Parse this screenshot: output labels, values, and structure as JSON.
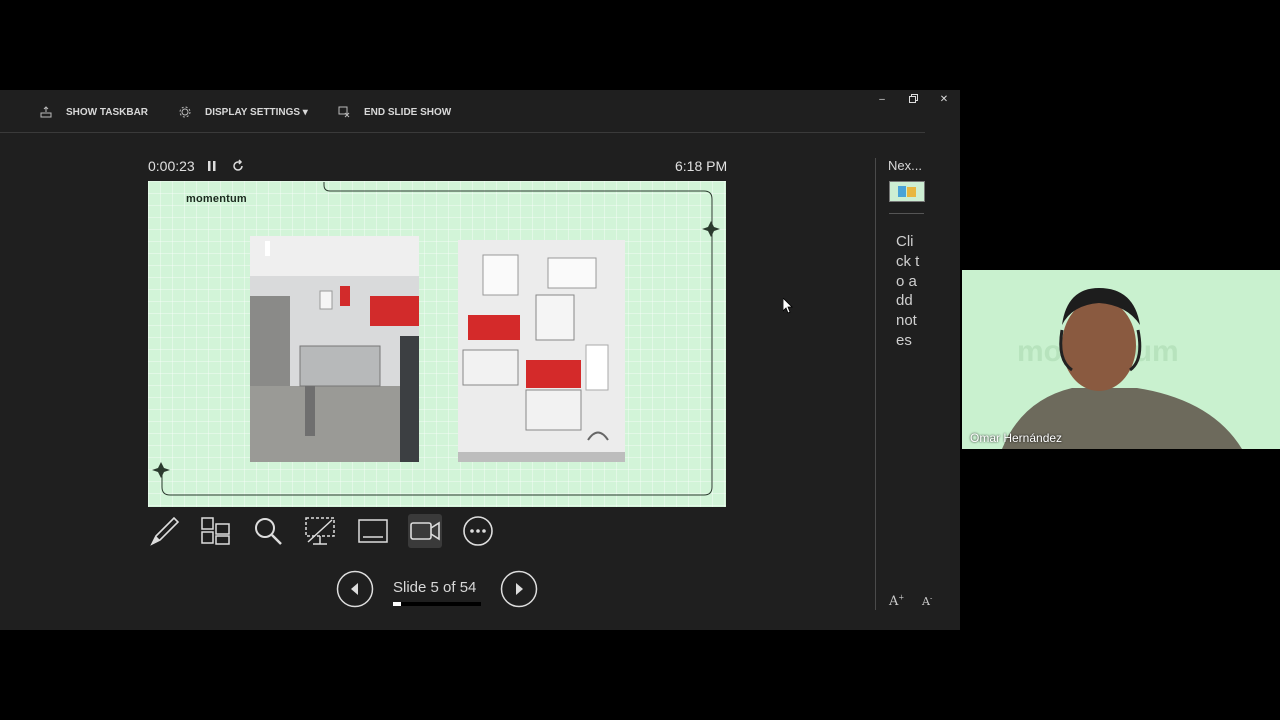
{
  "toolbar": {
    "show_taskbar": "SHOW TASKBAR",
    "display_settings": "DISPLAY SETTINGS ▾",
    "end_slide_show": "END SLIDE SHOW"
  },
  "presenter": {
    "timer": "0:00:23",
    "clock": "6:18 PM",
    "slide_counter": "Slide 5 of 54",
    "progress": 0.093,
    "next_label": "Nex...",
    "notes_placeholder": "Click to add notes"
  },
  "slide": {
    "logo": "momentum"
  },
  "video": {
    "participant_name": "Omar Hernández",
    "watermark": "momentum"
  },
  "icons": [
    "taskbar-icon",
    "display-settings-icon",
    "end-show-icon",
    "pause-icon",
    "restart-icon",
    "pen-icon",
    "slides-grid-icon",
    "zoom-icon",
    "black-screen-icon",
    "subtitles-icon",
    "camera-icon",
    "more-icon",
    "prev-icon",
    "next-icon",
    "font-increase-icon",
    "font-decrease-icon"
  ],
  "colors": {
    "slide_bg": "#d2f4d8",
    "presenter_bg": "#1f1f1f"
  }
}
